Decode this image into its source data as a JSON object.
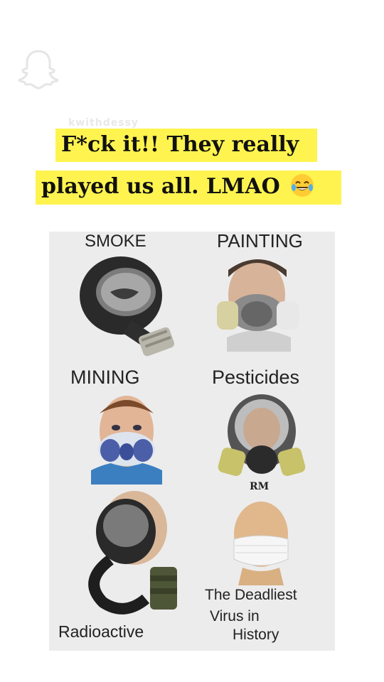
{
  "watermark_tag": "kwithdessy",
  "caption": {
    "line1": "F*ck it!! They really",
    "line2": "played us all. LMAO",
    "emoji": "face-with-tears-of-joy-icon"
  },
  "meme": {
    "labels": {
      "smoke": "SMOKE",
      "painting": "PAINTING",
      "mining": "MINING",
      "pesticides": "Pesticides",
      "radioactive": "Radioactive",
      "deadliest_1": "The Deadliest",
      "deadliest_2": "Virus in",
      "deadliest_3": "History",
      "signature": "RM"
    }
  },
  "colors": {
    "caption_bg": "#fff44f",
    "panel_bg": "#ececec"
  }
}
